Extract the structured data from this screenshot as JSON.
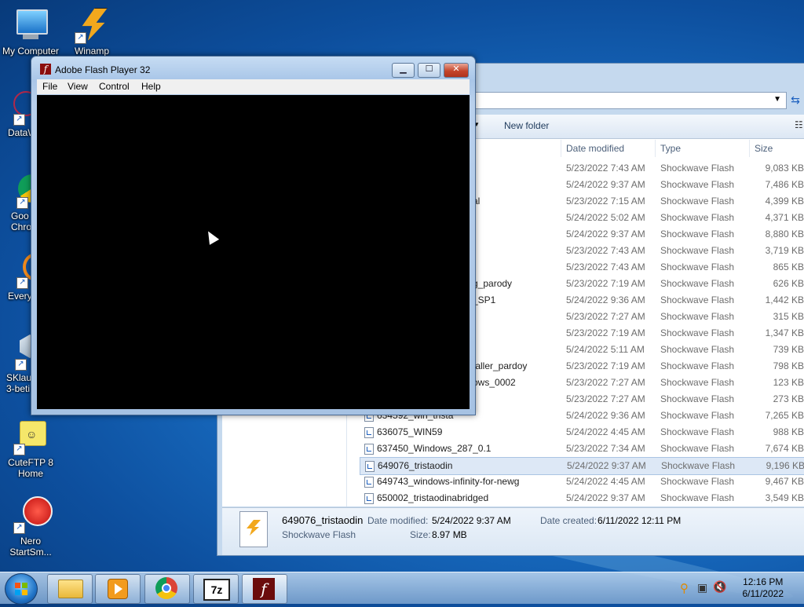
{
  "desktop": {
    "icons": [
      {
        "label": "My Computer"
      },
      {
        "label": "Winamp"
      },
      {
        "label": "DataW"
      },
      {
        "label": "Goo\nChro"
      },
      {
        "label": "Every"
      },
      {
        "label": "SKlau\n3-beti"
      },
      {
        "label": "CuteFTP 8\nHome"
      },
      {
        "label": "Nero\nStartSm..."
      }
    ]
  },
  "flash_window": {
    "title": "Adobe Flash Player 32",
    "menu": [
      "File",
      "View",
      "Control",
      "Help"
    ],
    "buttons": {
      "minimize": "▁",
      "maximize": "☐",
      "close": "✕"
    }
  },
  "explorer": {
    "toolbar": {
      "new_folder": "New folder"
    },
    "columns": {
      "date": "Date modified",
      "type": "Type",
      "size": "Size"
    },
    "rows": [
      {
        "name": "r",
        "date": "5/23/2022 7:43 AM",
        "type": "Shockwave Flash",
        "size": "9,083 KB"
      },
      {
        "name": "",
        "date": "5/24/2022 9:37 AM",
        "type": "Shockwave Flash",
        "size": "7,486 KB"
      },
      {
        "name": "al",
        "date": "5/23/2022 7:15 AM",
        "type": "Shockwave Flash",
        "size": "4,399 KB"
      },
      {
        "name": "",
        "date": "5/24/2022 5:02 AM",
        "type": "Shockwave Flash",
        "size": "4,371 KB"
      },
      {
        "name": "",
        "date": "5/24/2022 9:37 AM",
        "type": "Shockwave Flash",
        "size": "8,880 KB"
      },
      {
        "name": "",
        "date": "5/23/2022 7:43 AM",
        "type": "Shockwave Flash",
        "size": "3,719 KB"
      },
      {
        "name": "",
        "date": "5/23/2022 7:43 AM",
        "type": "Shockwave Flash",
        "size": "865 KB"
      },
      {
        "name": "g_parody",
        "date": "5/23/2022 7:19 AM",
        "type": "Shockwave Flash",
        "size": "626 KB"
      },
      {
        "name": "_SP1",
        "date": "5/24/2022 9:36 AM",
        "type": "Shockwave Flash",
        "size": "1,442 KB"
      },
      {
        "name": "",
        "date": "5/23/2022 7:27 AM",
        "type": "Shockwave Flash",
        "size": "315 KB"
      },
      {
        "name": "",
        "date": "5/23/2022 7:19 AM",
        "type": "Shockwave Flash",
        "size": "1,347 KB"
      },
      {
        "name": "",
        "date": "5/24/2022 5:11 AM",
        "type": "Shockwave Flash",
        "size": "739 KB"
      },
      {
        "name": "taller_pardoy",
        "date": "5/23/2022 7:19 AM",
        "type": "Shockwave Flash",
        "size": "798 KB"
      },
      {
        "name": "ows_0002",
        "date": "5/23/2022 7:27 AM",
        "type": "Shockwave Flash",
        "size": "123 KB"
      },
      {
        "name": "",
        "date": "5/23/2022 7:27 AM",
        "type": "Shockwave Flash",
        "size": "273 KB"
      },
      {
        "name": "634592_win_trista",
        "date": "5/24/2022 9:36 AM",
        "type": "Shockwave Flash",
        "size": "7,265 KB"
      },
      {
        "name": "636075_WIN59",
        "date": "5/24/2022 4:45 AM",
        "type": "Shockwave Flash",
        "size": "988 KB"
      },
      {
        "name": "637450_Windows_287_0.1",
        "date": "5/23/2022 7:34 AM",
        "type": "Shockwave Flash",
        "size": "7,674 KB"
      },
      {
        "name": "649076_tristaodin",
        "date": "5/24/2022 9:37 AM",
        "type": "Shockwave Flash",
        "size": "9,196 KB",
        "selected": true
      },
      {
        "name": "649743_windows-infinity-for-newg",
        "date": "5/24/2022 4:45 AM",
        "type": "Shockwave Flash",
        "size": "9,467 KB"
      },
      {
        "name": "650002_tristaodinabridged",
        "date": "5/24/2022 9:37 AM",
        "type": "Shockwave Flash",
        "size": "3,549 KB"
      }
    ],
    "details": {
      "name": "649076_tristaodin",
      "type": "Shockwave Flash",
      "modified_label": "Date modified:",
      "modified_value": "5/24/2022 9:37 AM",
      "created_label": "Date created:",
      "created_value": "6/11/2022 12:11 PM",
      "size_label": "Size:",
      "size_value": "8.97 MB"
    }
  },
  "taskbar": {
    "buttons": [
      "explorer",
      "media",
      "chrome",
      "7zip",
      "flash"
    ],
    "clock": {
      "time": "12:16 PM",
      "date": "6/11/2022"
    }
  }
}
